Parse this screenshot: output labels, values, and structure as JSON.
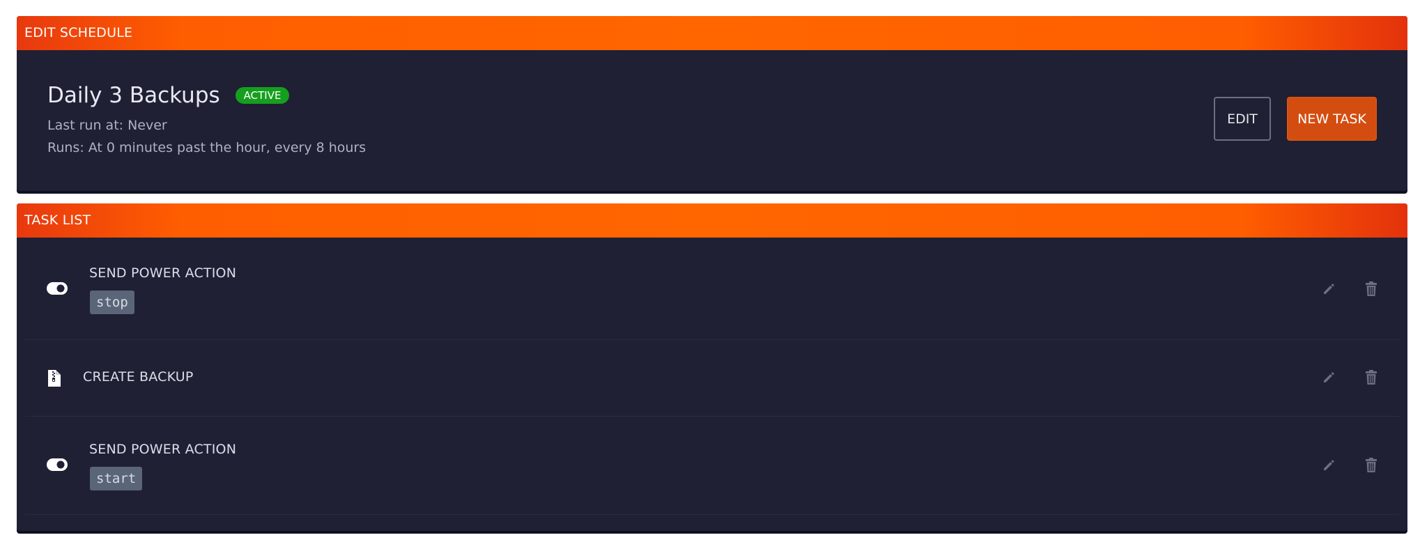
{
  "schedule_panel": {
    "header": "EDIT SCHEDULE",
    "title": "Daily 3 Backups",
    "status_badge": "ACTIVE",
    "last_run": "Last run at: Never",
    "runs": "Runs: At 0 minutes past the hour, every 8 hours",
    "edit_label": "EDIT",
    "new_task_label": "NEW TASK"
  },
  "task_panel": {
    "header": "TASK LIST",
    "tasks": [
      {
        "label": "SEND POWER ACTION",
        "code": "stop",
        "icon": "toggle-icon"
      },
      {
        "label": "CREATE BACKUP",
        "code": "",
        "icon": "file-archive-icon"
      },
      {
        "label": "SEND POWER ACTION",
        "code": "start",
        "icon": "toggle-icon"
      }
    ],
    "edit_icon": "pencil-icon",
    "delete_icon": "trash-icon"
  },
  "colors": {
    "accent": "#ff6600",
    "panel_bg": "#1f2033",
    "badge_active": "#169e1f",
    "new_task_button": "#d44d10"
  }
}
